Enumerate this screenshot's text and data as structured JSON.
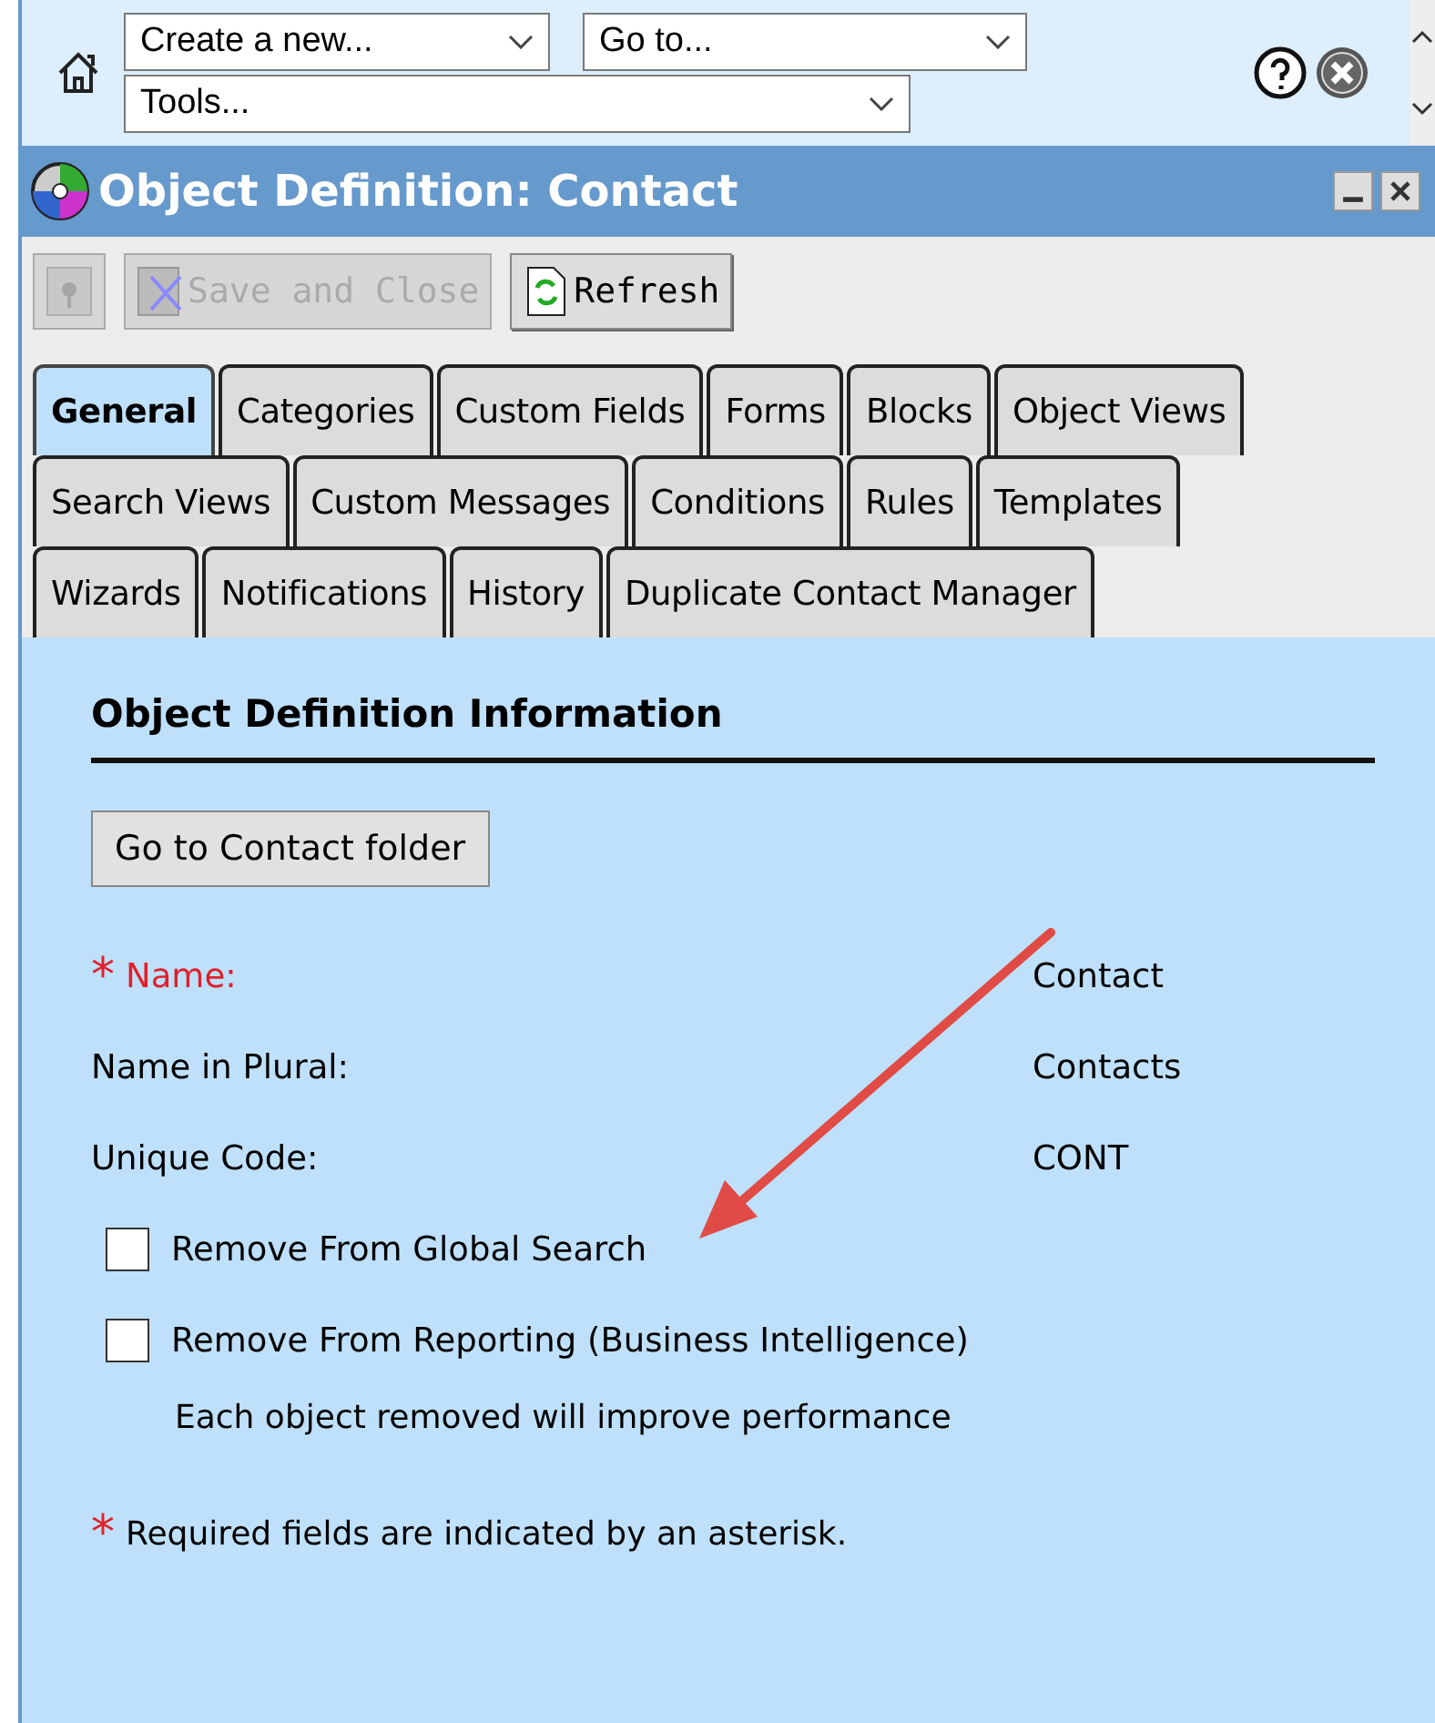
{
  "top_bar": {
    "dropdowns": [
      {
        "value": "Create a new..."
      },
      {
        "value": "Go to..."
      },
      {
        "value": "Tools..."
      }
    ]
  },
  "window": {
    "title": "Object Definition: Contact"
  },
  "toolbar": [
    {
      "kind": "icon",
      "disabled": true
    },
    {
      "kind": "text",
      "label": "Save and Close",
      "disabled": true
    },
    {
      "kind": "text",
      "label": "Refresh",
      "disabled": false
    }
  ],
  "tabs": [
    [
      {
        "label": "General",
        "selected": true
      },
      {
        "label": "Categories",
        "selected": false
      },
      {
        "label": "Custom Fields",
        "selected": false
      },
      {
        "label": "Forms",
        "selected": false
      },
      {
        "label": "Blocks",
        "selected": false
      },
      {
        "label": "Object Views",
        "selected": false
      }
    ],
    [
      {
        "label": "Search Views",
        "selected": false
      },
      {
        "label": "Custom Messages",
        "selected": false
      },
      {
        "label": "Conditions",
        "selected": false
      },
      {
        "label": "Rules",
        "selected": false
      },
      {
        "label": "Templates",
        "selected": false
      }
    ],
    [
      {
        "label": "Wizards",
        "selected": false
      },
      {
        "label": "Notifications",
        "selected": false
      },
      {
        "label": "History",
        "selected": false
      },
      {
        "label": "Duplicate Contact Manager",
        "selected": false
      }
    ]
  ],
  "section": {
    "title": "Object Definition Information",
    "button": "Go to Contact folder",
    "fields": [
      {
        "label": "Name:",
        "value": "Contact",
        "required": true,
        "asterisk": "*"
      },
      {
        "label": "Name in Plural:",
        "value": "Contacts",
        "required": false
      },
      {
        "label": "Unique Code:",
        "value": "CONT",
        "required": false
      }
    ],
    "checkboxes": [
      {
        "label": "Remove From Global Search",
        "checked": false
      },
      {
        "label": "Remove From Reporting (Business Intelligence)",
        "checked": false
      }
    ],
    "note": "Each object removed will improve performance",
    "footer": {
      "asterisk": "*",
      "text": "Required fields are indicated by an asterisk."
    }
  }
}
